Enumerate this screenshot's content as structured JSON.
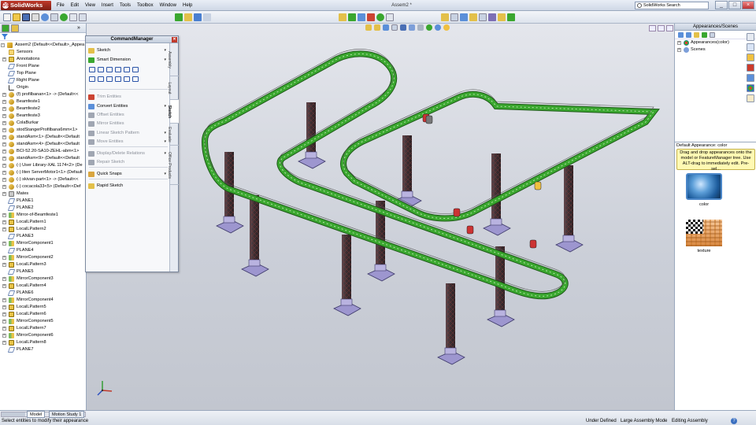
{
  "app": {
    "name": "SolidWorks",
    "document_title": "Assem2 *",
    "search_placeholder": "SolidWorks Search"
  },
  "menu": [
    "File",
    "Edit",
    "View",
    "Insert",
    "Tools",
    "Toolbox",
    "Window",
    "Help"
  ],
  "window_controls": [
    "_",
    "□",
    "×"
  ],
  "feature_tree": {
    "rows": [
      {
        "label": "Assem2  (Default<<Default>_Appea",
        "icon": "assembly-icon",
        "indent": 0,
        "expand": "-"
      },
      {
        "label": "Sensors",
        "icon": "sensor-folder-icon",
        "indent": 1,
        "expand": ""
      },
      {
        "label": "Annotations",
        "icon": "annotations-icon",
        "indent": 1,
        "expand": "+"
      },
      {
        "label": "Front Plane",
        "icon": "plane-icon",
        "indent": 1,
        "expand": ""
      },
      {
        "label": "Top Plane",
        "icon": "plane-icon",
        "indent": 1,
        "expand": ""
      },
      {
        "label": "Right Plane",
        "icon": "plane-icon",
        "indent": 1,
        "expand": ""
      },
      {
        "label": "Origin",
        "icon": "origin-icon",
        "indent": 1,
        "expand": ""
      },
      {
        "label": "(f) profilbanan<1> -> (Default<<",
        "icon": "part-icon",
        "indent": 1,
        "expand": "+"
      },
      {
        "label": "Beamfeste1",
        "icon": "part-icon",
        "indent": 1,
        "expand": "+"
      },
      {
        "label": "Beamfeste2",
        "icon": "part-icon",
        "indent": 1,
        "expand": "+"
      },
      {
        "label": "Beamfeste3",
        "icon": "part-icon",
        "indent": 1,
        "expand": "+"
      },
      {
        "label": "ColaBurkar",
        "icon": "part-icon",
        "indent": 1,
        "expand": "+"
      },
      {
        "label": "stodStangerProfilbana6mm<1>",
        "icon": "part-icon",
        "indent": 1,
        "expand": "+"
      },
      {
        "label": "standAsm<1> (Default<<Default",
        "icon": "part-icon",
        "indent": 1,
        "expand": "+"
      },
      {
        "label": "standAsm<4> (Default<<Default",
        "icon": "part-icon",
        "indent": 1,
        "expand": "+"
      },
      {
        "label": "BCI-52.20-SA10-ZEHL-abm<1>",
        "icon": "part-icon",
        "indent": 1,
        "expand": "+"
      },
      {
        "label": "standAsm<9> (Default<<Default",
        "icon": "part-icon",
        "indent": 1,
        "expand": "+"
      },
      {
        "label": "(-) User Library-XAL 1174<2> (De",
        "icon": "part-icon",
        "indent": 1,
        "expand": "+"
      },
      {
        "label": "(-) liten ServerMotor1<1> (Default",
        "icon": "part-icon",
        "indent": 1,
        "expand": "+"
      },
      {
        "label": "(-) skivan-part<1> -> (Default<<",
        "icon": "part-icon",
        "indent": 1,
        "expand": "+"
      },
      {
        "label": "(-) cocacola33<5> (Default<<Def",
        "icon": "part-icon",
        "indent": 1,
        "expand": "+"
      },
      {
        "label": "Mates",
        "icon": "mates-icon",
        "indent": 1,
        "expand": "+"
      },
      {
        "label": "PLANE1",
        "icon": "plane-icon",
        "indent": 1,
        "expand": ""
      },
      {
        "label": "PLANE2",
        "icon": "plane-icon",
        "indent": 1,
        "expand": ""
      },
      {
        "label": "Mirror-of-Beamfeste1",
        "icon": "mirror-icon",
        "indent": 1,
        "expand": "+"
      },
      {
        "label": "LocalLPattern1",
        "icon": "pattern-icon",
        "indent": 1,
        "expand": "+"
      },
      {
        "label": "LocalLPattern2",
        "icon": "pattern-icon",
        "indent": 1,
        "expand": "+"
      },
      {
        "label": "PLANE3",
        "icon": "plane-icon",
        "indent": 1,
        "expand": ""
      },
      {
        "label": "MirrorComponent1",
        "icon": "mirror-icon",
        "indent": 1,
        "expand": "+"
      },
      {
        "label": "PLANE4",
        "icon": "plane-icon",
        "indent": 1,
        "expand": ""
      },
      {
        "label": "MirrorComponent2",
        "icon": "mirror-icon",
        "indent": 1,
        "expand": "+"
      },
      {
        "label": "LocalLPattern3",
        "icon": "pattern-icon",
        "indent": 1,
        "expand": "+"
      },
      {
        "label": "PLANE5",
        "icon": "plane-icon",
        "indent": 1,
        "expand": ""
      },
      {
        "label": "MirrorComponent3",
        "icon": "mirror-icon",
        "indent": 1,
        "expand": "+"
      },
      {
        "label": "LocalLPattern4",
        "icon": "pattern-icon",
        "indent": 1,
        "expand": "+"
      },
      {
        "label": "PLANE6",
        "icon": "plane-icon",
        "indent": 1,
        "expand": ""
      },
      {
        "label": "MirrorComponent4",
        "icon": "mirror-icon",
        "indent": 1,
        "expand": "+"
      },
      {
        "label": "LocalLPattern5",
        "icon": "pattern-icon",
        "indent": 1,
        "expand": "+"
      },
      {
        "label": "LocalLPattern6",
        "icon": "pattern-icon",
        "indent": 1,
        "expand": "+"
      },
      {
        "label": "MirrorComponent5",
        "icon": "mirror-icon",
        "indent": 1,
        "expand": "+"
      },
      {
        "label": "LocalLPattern7",
        "icon": "pattern-icon",
        "indent": 1,
        "expand": "+"
      },
      {
        "label": "MirrorComponent6",
        "icon": "mirror-icon",
        "indent": 1,
        "expand": "+"
      },
      {
        "label": "LocalLPattern8",
        "icon": "pattern-icon",
        "indent": 1,
        "expand": "+"
      },
      {
        "label": "PLANE7",
        "icon": "plane-icon",
        "indent": 1,
        "expand": ""
      }
    ],
    "bottom_tabs": [
      "Model",
      "Motion Study 1"
    ]
  },
  "command_manager": {
    "title": "CommandManager",
    "items": [
      {
        "label": "Sketch",
        "disabled": false,
        "dropdown": true,
        "icon": "sketch-icon"
      },
      {
        "label": "Smart Dimension",
        "disabled": false,
        "dropdown": true,
        "icon": "smart-dimension-icon"
      },
      {
        "label": "Trim Entities",
        "disabled": true,
        "dropdown": false,
        "icon": "trim-icon"
      },
      {
        "label": "Convert Entities",
        "disabled": false,
        "dropdown": true,
        "icon": "convert-icon"
      },
      {
        "label": "Offset Entities",
        "disabled": true,
        "dropdown": false,
        "icon": "offset-icon"
      },
      {
        "label": "Mirror Entities",
        "disabled": true,
        "dropdown": false,
        "icon": "mirror-entities-icon"
      },
      {
        "label": "Linear Sketch Pattern",
        "disabled": true,
        "dropdown": true,
        "icon": "linear-pattern-icon"
      },
      {
        "label": "Move Entities",
        "disabled": true,
        "dropdown": true,
        "icon": "move-icon"
      },
      {
        "label": "Display/Delete Relations",
        "disabled": true,
        "dropdown": true,
        "icon": "relations-icon"
      },
      {
        "label": "Repair Sketch",
        "disabled": true,
        "dropdown": false,
        "icon": "repair-icon"
      },
      {
        "label": "Quick Snaps",
        "disabled": false,
        "dropdown": true,
        "icon": "quick-snaps-icon"
      },
      {
        "label": "Rapid Sketch",
        "disabled": false,
        "dropdown": false,
        "icon": "rapid-sketch-icon"
      }
    ],
    "side_tabs": [
      "Assembly",
      "Layout",
      "Sketch",
      "Evaluate",
      "Office Products"
    ],
    "active_tab": "Sketch"
  },
  "appearances": {
    "title": "Appearances/Scenes",
    "tree": [
      {
        "label": "Appearances(color)",
        "icon": "appearance-icon"
      },
      {
        "label": "Scenes",
        "icon": "scene-icon"
      }
    ],
    "default_label": "Default Appearance: color",
    "tip": "Drag and drop appearances onto the model or FeatureManager tree.  Use ALT-drag to immediately edit.  Pre-sel...",
    "swatches": [
      {
        "label": "color"
      },
      {
        "label": "texture"
      }
    ]
  },
  "status": {
    "message": "Select entities to modify their appearance",
    "under_defined": "Under Defined",
    "large_assembly": "Large Assembly Mode",
    "editing": "Editing Assembly",
    "help": "?"
  },
  "colors": {
    "track_green": "#3aa72f",
    "pillar_dark": "#4a3a3e",
    "base_purple": "#9d96cf",
    "viewport_bg": "#d2d5dd",
    "brand_red": "#b8281c"
  }
}
